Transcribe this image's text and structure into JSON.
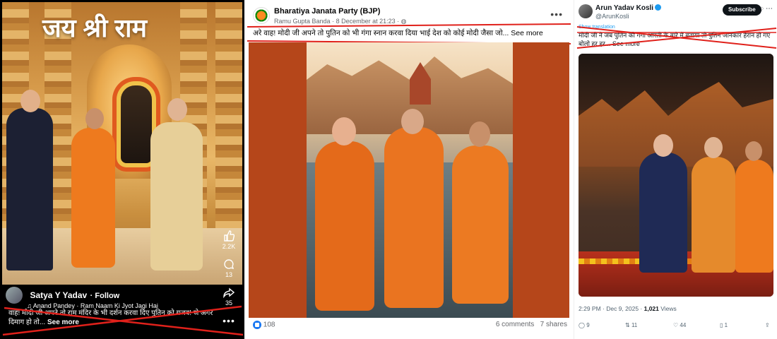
{
  "reel": {
    "overlay_title": "जय श्री राम",
    "likes": "2.2K",
    "comments": "13",
    "shares": "35",
    "author": "Satya Y Yadav",
    "follow_label": "Follow",
    "music": "Anand Pandey · Ram Naam Ki Jyot Jagi Hai",
    "caption": "वाह! मोदी जी अपने तो राम मंदिर के भी दर्शन करवा दिए पुतिन को गजब! जे अगर दिमाग हो तो...",
    "see_more": "See more"
  },
  "fb_post": {
    "page_name": "Bharatiya Janata Party (BJP)",
    "author": "Ramu Gupta Banda",
    "timestamp": "8 December at 21:23",
    "text": "अरे वाह! मोदी जी अपने तो पुतिन को भी गंगा स्नान करवा दिया भाई देश को कोई मोदी जैसा जो...",
    "see_more": "See more",
    "reactions": "108",
    "comments": "6 comments",
    "shares": "7 shares"
  },
  "x_post": {
    "display_name": "Arun Yadav Kosli",
    "handle": "@ArunKosli",
    "subscribe_label": "Subscribe",
    "show_translation": "Show translation",
    "text": "मोदी जी ने जब पुतिन को गंगा आरती के बारे में बताया तो पुतिन जानकार हैरान हो गए बोलो हर हर...",
    "see_more": "See more",
    "time": "2:29 PM · Dec 9, 2025 · ",
    "views_count": "1,021",
    "views_label": " Views",
    "replies": "9",
    "reposts": "11",
    "likes": "44",
    "bookmarks": "1"
  },
  "colors": {
    "strike": "#e0211b",
    "fb_blue": "#1877f2",
    "saffron": "#e8731c"
  }
}
